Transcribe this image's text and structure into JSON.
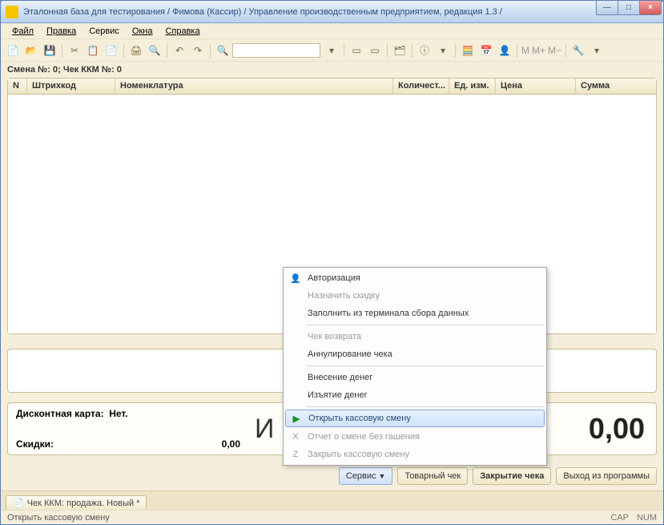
{
  "window": {
    "title": "Эталонная база для тестирования / Фимова (Кассир) /  Управление производственным предприятием, редакция 1.3 /",
    "min_glyph": "—",
    "max_glyph": "□",
    "close_glyph": "×"
  },
  "menu": {
    "file": "Файл",
    "edit": "Правка",
    "service": "Сервис",
    "windows": "Окна",
    "help": "Справка"
  },
  "toolbar": {
    "textfield_value": "",
    "m": "M",
    "mplus": "M+",
    "mminus": "M−"
  },
  "header": {
    "shift_line": "Смена №: 0; Чек ККМ №: 0"
  },
  "grid": {
    "columns": {
      "n": "N",
      "barcode": "Штрихкод",
      "nom": "Номенклатура",
      "qty": "Количест...",
      "uom": "Ед. изм.",
      "price": "Цена",
      "sum": "Сумма"
    }
  },
  "bottom": {
    "discount_card_label": "Дисконтная карта:",
    "discount_card_value": "Нет.",
    "discounts_label": "Скидки:",
    "discounts_value": "0,00",
    "big_fragment": "И",
    "total": "0,00"
  },
  "buttons": {
    "service": "Сервис",
    "receipt": "Товарный чек",
    "close_check": "Закрытие чека",
    "exit": "Выход из программы"
  },
  "tab": {
    "label": "Чек ККМ: продажа. Новый *"
  },
  "status": {
    "text": "Открыть кассовую смену",
    "cap": "CAP",
    "num": "NUM"
  },
  "context_menu": {
    "auth": "Авторизация",
    "assign_discount": "Назначить скидку",
    "fill_terminal": "Заполнить из терминала сбора данных",
    "return_check": "Чек возврата",
    "annul": "Аннулирование чека",
    "deposit": "Внесение денег",
    "withdraw": "Изъятие денег",
    "open_shift": "Открыть кассовую смену",
    "report_no_reset": "Отчет о смене без гашения",
    "close_shift": "Закрыть кассовую смену"
  }
}
